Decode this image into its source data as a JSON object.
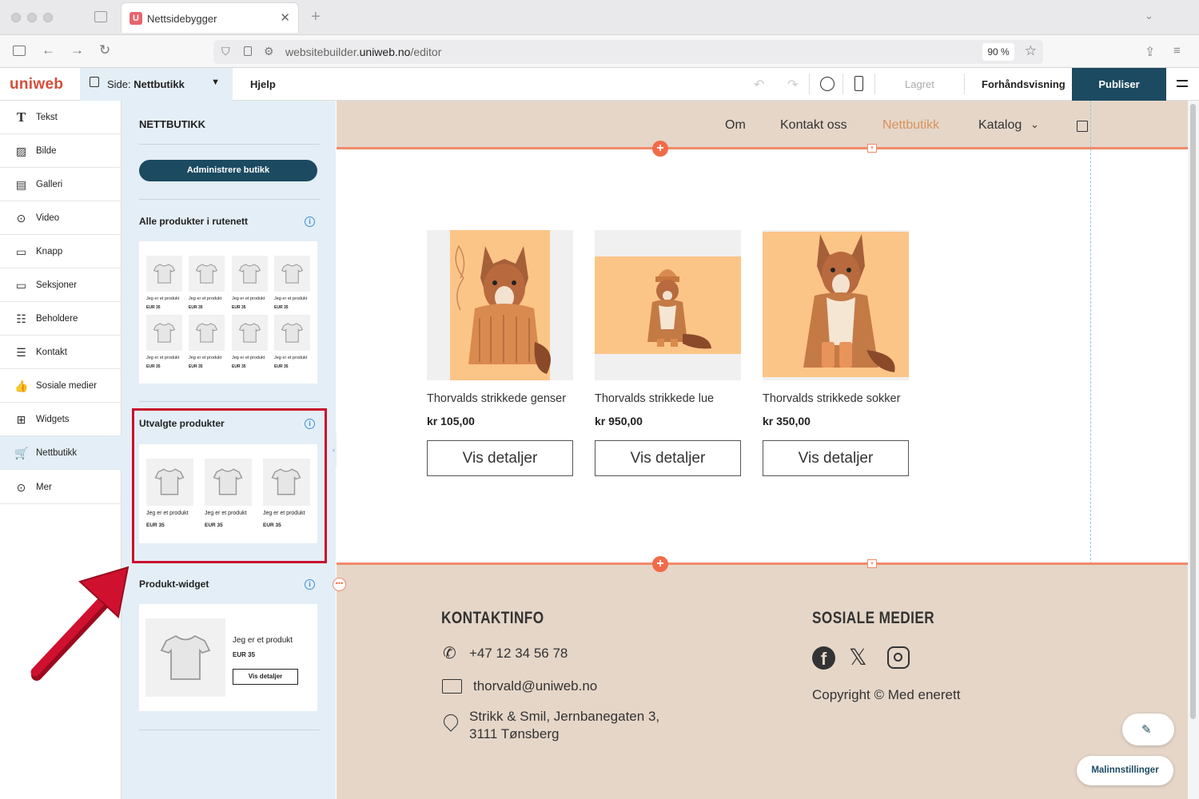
{
  "browser": {
    "tab_title": "Nettsidebygger",
    "tab_favicon": "U",
    "url_prefix": "websitebuilder.",
    "url_host": "uniweb.no",
    "url_path": "/editor",
    "zoom": "90 %"
  },
  "toolbar": {
    "logo": "uniweb",
    "page_label": "Side: ",
    "page_name": "Nettbutikk",
    "help": "Hjelp",
    "saved": "Lagret",
    "preview": "Forhåndsvisning",
    "publish": "Publiser"
  },
  "sidebar": {
    "items": [
      {
        "label": "Tekst",
        "icon": "text-icon"
      },
      {
        "label": "Bilde",
        "icon": "image-icon"
      },
      {
        "label": "Galleri",
        "icon": "gallery-icon"
      },
      {
        "label": "Video",
        "icon": "video-icon"
      },
      {
        "label": "Knapp",
        "icon": "button-icon"
      },
      {
        "label": "Seksjoner",
        "icon": "sections-icon"
      },
      {
        "label": "Beholdere",
        "icon": "containers-icon"
      },
      {
        "label": "Kontakt",
        "icon": "contact-icon"
      },
      {
        "label": "Sosiale medier",
        "icon": "thumbs-up-icon"
      },
      {
        "label": "Widgets",
        "icon": "widgets-icon"
      },
      {
        "label": "Nettbutikk",
        "icon": "cart-icon"
      },
      {
        "label": "Mer",
        "icon": "more-icon"
      }
    ]
  },
  "panel": {
    "title": "NETTBUTIKK",
    "admin_button": "Administrere butikk",
    "sections": [
      {
        "title": "Alle produkter i rutenett"
      },
      {
        "title": "Utvalgte produkter"
      },
      {
        "title": "Produkt-widget"
      }
    ],
    "mini_product_name": "Jeg er et produkt",
    "mini_product_price": "EUR 35",
    "widget_button": "Vis detaljer"
  },
  "site": {
    "menu": [
      "Om",
      "Kontakt oss",
      "Nettbutikk",
      "Katalog"
    ],
    "products": [
      {
        "name": "Thorvalds strikkede genser",
        "price": "kr 105,00",
        "button": "Vis detaljer"
      },
      {
        "name": "Thorvalds strikkede lue",
        "price": "kr 950,00",
        "button": "Vis detaljer"
      },
      {
        "name": "Thorvalds strikkede sokker",
        "price": "kr 350,00",
        "button": "Vis detaljer"
      }
    ],
    "footer": {
      "contact_heading": "KONTAKTINFO",
      "phone": "+47 12 34 56 78",
      "email": "thorvald@uniweb.no",
      "address_line1": "Strikk & Smil, Jernbanegaten 3,",
      "address_line2": "3111 Tønsberg",
      "social_heading": "SOSIALE MEDIER",
      "copyright": "Copyright © Med enerett"
    }
  },
  "template_settings": "Malinnstillinger",
  "colors": {
    "accent": "#1b4a61",
    "brand": "#d64c3a",
    "active_menu": "#d9935e",
    "highlight": "#c8102e",
    "site_bg": "#e5d6c8"
  }
}
